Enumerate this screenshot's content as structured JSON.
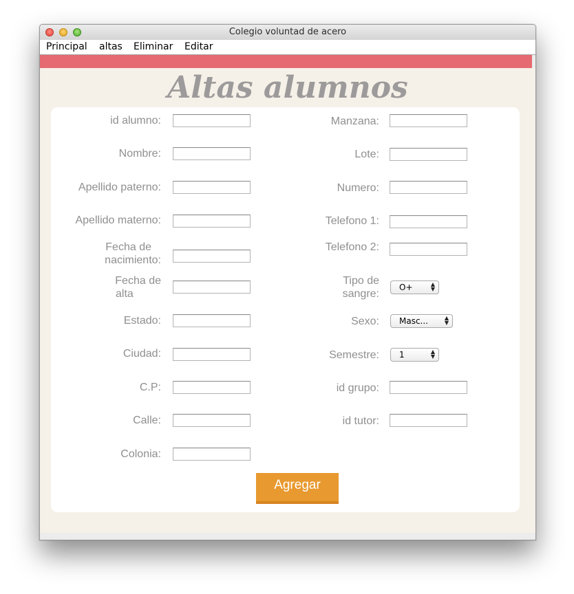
{
  "window": {
    "title": "Colegio voluntad de acero"
  },
  "menu": [
    "Principal",
    "altas",
    "Eliminar",
    "Editar"
  ],
  "heading": "Altas alumnos",
  "left_fields": [
    {
      "label": "id alumno:",
      "value": ""
    },
    {
      "label": "Nombre:",
      "value": ""
    },
    {
      "label": "Apellido paterno:",
      "value": ""
    },
    {
      "label": "Apellido materno:",
      "value": ""
    },
    {
      "label_lines": [
        "Fecha de",
        "nacimiento:"
      ],
      "value": ""
    },
    {
      "label_lines": [
        "Fecha de",
        "alta"
      ],
      "value": ""
    },
    {
      "label": "Estado:",
      "value": ""
    },
    {
      "label": "Ciudad:",
      "value": ""
    },
    {
      "label": "C.P:",
      "value": ""
    },
    {
      "label": "Calle:",
      "value": ""
    },
    {
      "label": "Colonia:",
      "value": ""
    }
  ],
  "right_fields": [
    {
      "label": "Manzana:",
      "value": ""
    },
    {
      "label": "Lote:",
      "value": ""
    },
    {
      "label": "Numero:",
      "value": ""
    },
    {
      "label": "Telefono 1:",
      "value": ""
    },
    {
      "label": "Telefono 2:",
      "value": ""
    },
    {
      "label_lines": [
        "Tipo de",
        "sangre:"
      ],
      "selected": "O+"
    },
    {
      "label": "Sexo:",
      "selected": "Masc..."
    },
    {
      "label": "Semestre:",
      "selected": "1"
    },
    {
      "label": "id grupo:",
      "value": ""
    },
    {
      "label": "id tutor:",
      "value": ""
    }
  ],
  "submit_label": "Agregar",
  "colors": {
    "pink_bar": "#e66a71",
    "button": "#e8992f",
    "background": "#f5f1e8",
    "label": "#8f8f8f"
  }
}
